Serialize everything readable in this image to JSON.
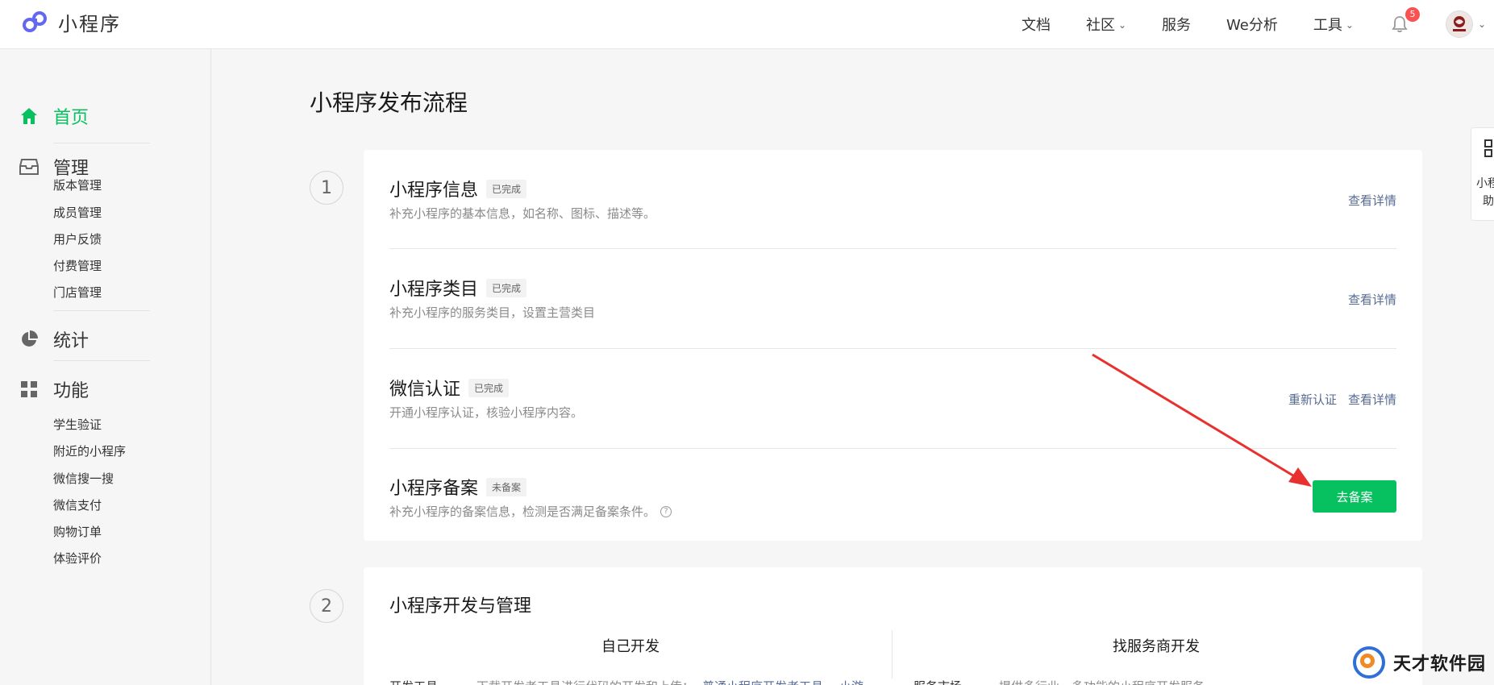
{
  "header": {
    "brand_name": "小程序",
    "nav": [
      {
        "label": "文档",
        "has_dropdown": false
      },
      {
        "label": "社区",
        "has_dropdown": true
      },
      {
        "label": "服务",
        "has_dropdown": false
      },
      {
        "label": "We分析",
        "has_dropdown": false
      },
      {
        "label": "工具",
        "has_dropdown": true
      }
    ],
    "notification_count": "5",
    "accent_color": "#07c160"
  },
  "sidebar": {
    "home": "首页",
    "manage": "管理",
    "manage_items": [
      "版本管理",
      "成员管理",
      "用户反馈",
      "付费管理",
      "门店管理"
    ],
    "stats": "统计",
    "features": "功能",
    "feature_items": [
      "学生验证",
      "附近的小程序",
      "微信搜一搜",
      "微信支付",
      "购物订单",
      "体验评价"
    ]
  },
  "main": {
    "page_title": "小程序发布流程",
    "step1": {
      "number": "1",
      "rows": [
        {
          "title": "小程序信息",
          "tag": "已完成",
          "desc": "补充小程序的基本信息，如名称、图标、描述等。",
          "actions": [
            "查看详情"
          ]
        },
        {
          "title": "小程序类目",
          "tag": "已完成",
          "desc": "补充小程序的服务类目，设置主营类目",
          "actions": [
            "查看详情"
          ]
        },
        {
          "title": "微信认证",
          "tag": "已完成",
          "desc": "开通小程序认证，核验小程序内容。",
          "actions": [
            "重新认证",
            "查看详情"
          ]
        },
        {
          "title": "小程序备案",
          "tag": "未备案",
          "desc": "补充小程序的备案信息，检测是否满足备案条件。",
          "button": "去备案"
        }
      ]
    },
    "step2": {
      "number": "2",
      "title": "小程序开发与管理",
      "col_left": "自己开发",
      "col_right": "找服务商开发",
      "left_label": "开发工具",
      "left_desc": "下载开发者工具进行代码的开发和上传：",
      "left_link1": "普通小程序开发者工具",
      "left_link2": "小游",
      "right_label": "服务市场",
      "right_desc": "提供多行业、多功能的小程序开发服务"
    }
  },
  "float_helper": {
    "line1": "小程",
    "line2": "助"
  },
  "watermark": "天才软件园"
}
